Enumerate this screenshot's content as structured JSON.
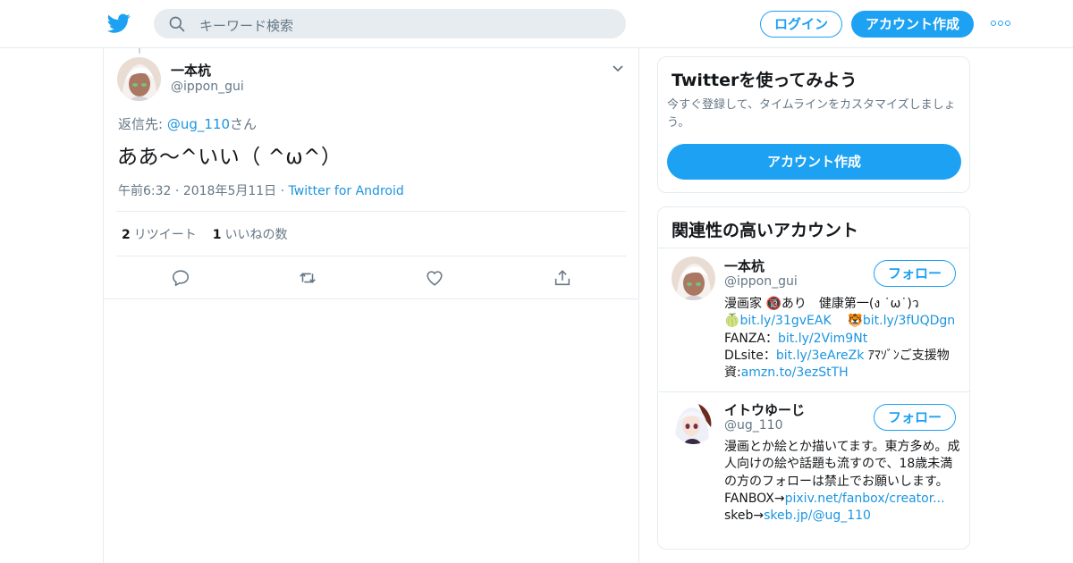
{
  "header": {
    "search_placeholder": "キーワード検索",
    "login_label": "ログイン",
    "signup_label": "アカウント作成"
  },
  "tweet": {
    "name": "一本杭",
    "handle": "@ippon_gui",
    "reply_prefix": "返信先: ",
    "reply_to": "@ug_110",
    "reply_suffix": "さん",
    "text": "ああ〜^いい（ ^ω^）",
    "time": "午前6:32",
    "date": "2018年5月11日",
    "source": "Twitter for Android",
    "retweet_count": "2",
    "retweet_label": "リツイート",
    "like_count": "1",
    "like_label": "いいねの数"
  },
  "signup_card": {
    "title": "Twitterを使ってみよう",
    "description": "今すぐ登録して、タイムラインをカスタマイズしましょう。",
    "button": "アカウント作成"
  },
  "related": {
    "title": "関連性の高いアカウント",
    "accounts": [
      {
        "name": "一本杭",
        "handle": "@ippon_gui",
        "follow_label": "フォロー",
        "bio_line1": "漫画家 🔞あり　健康第一(ง ˙ω˙)ว",
        "bio_emoji1": "🍈",
        "bio_link1": "bit.ly/31gvEAK",
        "bio_emoji2": "🐯",
        "bio_link2": "bit.ly/3fUQDgn",
        "bio_fanza_label": "FANZA：",
        "bio_fanza_link": "bit.ly/2Vim9Nt",
        "bio_dl_label": "DLsite：",
        "bio_dl_link": "bit.ly/3eAreZk",
        "bio_amazon_label": " ｱﾏｿﾞﾝご支援物資:",
        "bio_amazon_link": "amzn.to/3ezStTH"
      },
      {
        "name": "イトウゆーじ",
        "handle": "@ug_110",
        "follow_label": "フォロー",
        "bio_text": "漫画とか絵とか描いてます。東方多め。成人向けの絵や話題も流すので、18歳未満の方のフォローは禁止でお願いします。",
        "bio_fanbox_label": "FANBOX→",
        "bio_fanbox_link": "pixiv.net/fanbox/creator...",
        "bio_skeb_label": "skeb→",
        "bio_skeb_link": "skeb.jp/@ug_110"
      }
    ]
  },
  "colors": {
    "accent": "#1da1f2",
    "link": "#1b95e0",
    "secondary_text": "#657786",
    "border": "#e6ecf0"
  },
  "icons": [
    "twitter-bird-icon",
    "search-icon",
    "more-dots-icon",
    "chevron-down-icon",
    "reply-icon",
    "retweet-icon",
    "like-icon",
    "share-icon"
  ]
}
